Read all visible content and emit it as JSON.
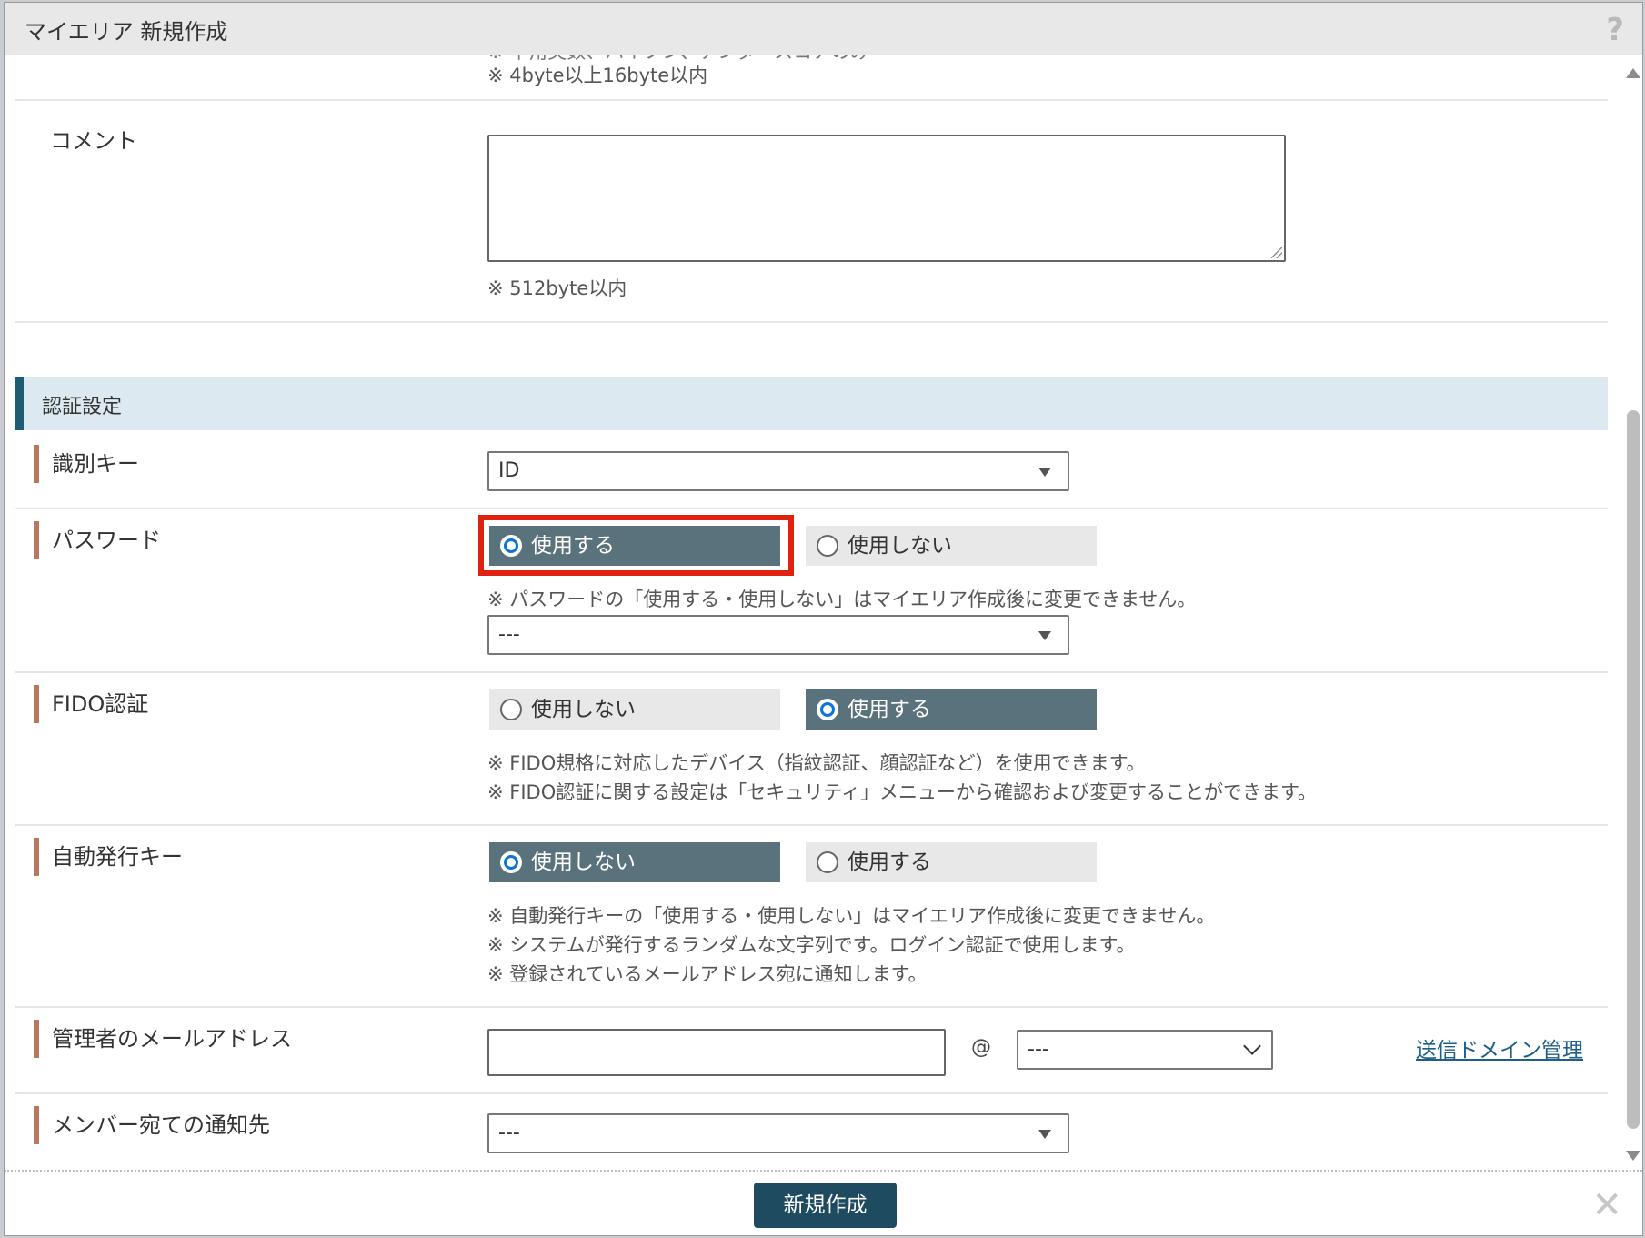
{
  "dialog": {
    "title": "マイエリア 新規作成",
    "help_icon": "?",
    "close_icon": "✕"
  },
  "top_notes": {
    "cut_line": "※ 半角英数、ハイフン、アンダースコアのみ",
    "length": "※ 4byte以上16byte以内"
  },
  "comment": {
    "label": "コメント",
    "value": "",
    "note": "※ 512byte以内"
  },
  "auth_section": {
    "title": "認証設定"
  },
  "id_key": {
    "label": "識別キー",
    "selected": "ID"
  },
  "password": {
    "label": "パスワード",
    "option_use": "使用する",
    "option_nouse": "使用しない",
    "selected": "使用する",
    "note": "※ パスワードの「使用する・使用しない」はマイエリア作成後に変更できません。",
    "policy_selected": "---"
  },
  "fido": {
    "label": "FIDO認証",
    "option_nouse": "使用しない",
    "option_use": "使用する",
    "selected": "使用する",
    "note1": "※ FIDO規格に対応したデバイス（指紋認証、顔認証など）を使用できます。",
    "note2": "※ FIDO認証に関する設定は「セキュリティ」メニューから確認および変更することができます。"
  },
  "auto_key": {
    "label": "自動発行キー",
    "option_nouse": "使用しない",
    "option_use": "使用する",
    "selected": "使用しない",
    "note1": "※ 自動発行キーの「使用する・使用しない」はマイエリア作成後に変更できません。",
    "note2": "※ システムが発行するランダムな文字列です。ログイン認証で使用します。",
    "note3": "※ 登録されているメールアドレス宛に通知します。"
  },
  "admin_email": {
    "label": "管理者のメールアドレス",
    "local_value": "",
    "at": "@",
    "domain_selected": "---",
    "domain_link": "送信ドメイン管理"
  },
  "member_notify": {
    "label": "メンバー宛ての通知先",
    "selected": "---"
  },
  "footer": {
    "create_label": "新規作成"
  },
  "colors": {
    "selected_radio_bg": "#5a727b",
    "unselected_radio_bg": "#e8e8e8",
    "section_bg": "#dce9f0",
    "section_accent": "#1d5c73",
    "label_marker": "#b9785e",
    "highlight_box": "#e1210f",
    "primary_button": "#1e4b5f",
    "link": "#1f5f87"
  }
}
